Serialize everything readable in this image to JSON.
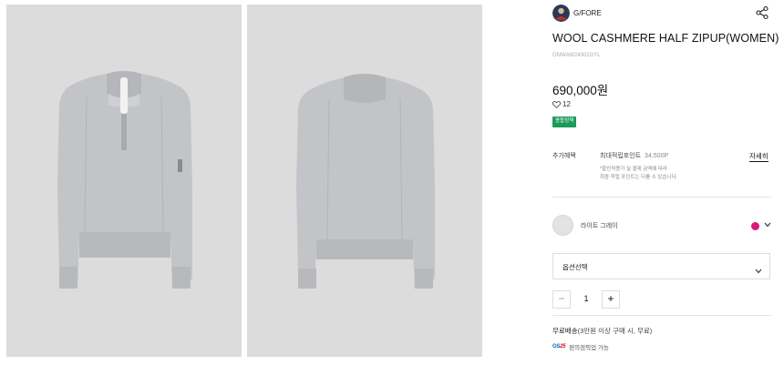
{
  "gallery": {
    "images": [
      {
        "alt": "front view - half zip sweater"
      },
      {
        "alt": "back view - half zip sweater"
      }
    ]
  },
  "brand": {
    "name": "G/FORE"
  },
  "product": {
    "title": "WOOL CASHMERE HALF ZIPUP(WOMEN)",
    "sku": "GNWAW24302GYL",
    "price": "690,000원",
    "likes": "12",
    "badge": "종합정책"
  },
  "benefit": {
    "label": "추가혜택",
    "point_label": "최대적립포인트",
    "point_value": "34,500P",
    "detail_link": "자세히",
    "note_line1": "*할인적용가 실 결제 금액에 따라",
    "note_line2": "최종 적립 포인트는 다를 수 있습니다."
  },
  "color": {
    "name": "라이트 그레이",
    "accent_dot": "#d6197a"
  },
  "option": {
    "label": "옵션선택"
  },
  "quantity": {
    "minus": "−",
    "value": "1",
    "plus": "+"
  },
  "shipping": {
    "title": "무료배송",
    "detail": "(3만원 이상 구매 시, 무료)"
  },
  "pickup": {
    "logo_g": "GS",
    "logo_n": "25",
    "text": "편의점픽업 가능"
  },
  "icons": [
    "share-icon",
    "heart-icon",
    "chevron-down-icon"
  ]
}
